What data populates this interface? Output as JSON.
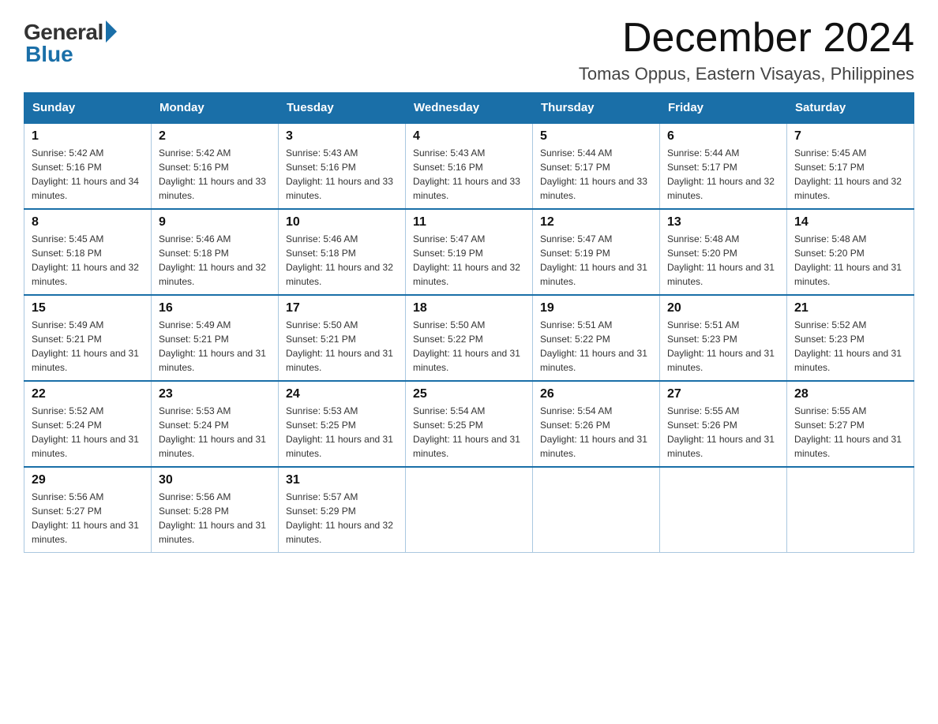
{
  "logo": {
    "general": "General",
    "blue": "Blue"
  },
  "title": "December 2024",
  "location": "Tomas Oppus, Eastern Visayas, Philippines",
  "weekdays": [
    "Sunday",
    "Monday",
    "Tuesday",
    "Wednesday",
    "Thursday",
    "Friday",
    "Saturday"
  ],
  "weeks": [
    [
      {
        "day": "1",
        "sunrise": "5:42 AM",
        "sunset": "5:16 PM",
        "daylight": "11 hours and 34 minutes."
      },
      {
        "day": "2",
        "sunrise": "5:42 AM",
        "sunset": "5:16 PM",
        "daylight": "11 hours and 33 minutes."
      },
      {
        "day": "3",
        "sunrise": "5:43 AM",
        "sunset": "5:16 PM",
        "daylight": "11 hours and 33 minutes."
      },
      {
        "day": "4",
        "sunrise": "5:43 AM",
        "sunset": "5:16 PM",
        "daylight": "11 hours and 33 minutes."
      },
      {
        "day": "5",
        "sunrise": "5:44 AM",
        "sunset": "5:17 PM",
        "daylight": "11 hours and 33 minutes."
      },
      {
        "day": "6",
        "sunrise": "5:44 AM",
        "sunset": "5:17 PM",
        "daylight": "11 hours and 32 minutes."
      },
      {
        "day": "7",
        "sunrise": "5:45 AM",
        "sunset": "5:17 PM",
        "daylight": "11 hours and 32 minutes."
      }
    ],
    [
      {
        "day": "8",
        "sunrise": "5:45 AM",
        "sunset": "5:18 PM",
        "daylight": "11 hours and 32 minutes."
      },
      {
        "day": "9",
        "sunrise": "5:46 AM",
        "sunset": "5:18 PM",
        "daylight": "11 hours and 32 minutes."
      },
      {
        "day": "10",
        "sunrise": "5:46 AM",
        "sunset": "5:18 PM",
        "daylight": "11 hours and 32 minutes."
      },
      {
        "day": "11",
        "sunrise": "5:47 AM",
        "sunset": "5:19 PM",
        "daylight": "11 hours and 32 minutes."
      },
      {
        "day": "12",
        "sunrise": "5:47 AM",
        "sunset": "5:19 PM",
        "daylight": "11 hours and 31 minutes."
      },
      {
        "day": "13",
        "sunrise": "5:48 AM",
        "sunset": "5:20 PM",
        "daylight": "11 hours and 31 minutes."
      },
      {
        "day": "14",
        "sunrise": "5:48 AM",
        "sunset": "5:20 PM",
        "daylight": "11 hours and 31 minutes."
      }
    ],
    [
      {
        "day": "15",
        "sunrise": "5:49 AM",
        "sunset": "5:21 PM",
        "daylight": "11 hours and 31 minutes."
      },
      {
        "day": "16",
        "sunrise": "5:49 AM",
        "sunset": "5:21 PM",
        "daylight": "11 hours and 31 minutes."
      },
      {
        "day": "17",
        "sunrise": "5:50 AM",
        "sunset": "5:21 PM",
        "daylight": "11 hours and 31 minutes."
      },
      {
        "day": "18",
        "sunrise": "5:50 AM",
        "sunset": "5:22 PM",
        "daylight": "11 hours and 31 minutes."
      },
      {
        "day": "19",
        "sunrise": "5:51 AM",
        "sunset": "5:22 PM",
        "daylight": "11 hours and 31 minutes."
      },
      {
        "day": "20",
        "sunrise": "5:51 AM",
        "sunset": "5:23 PM",
        "daylight": "11 hours and 31 minutes."
      },
      {
        "day": "21",
        "sunrise": "5:52 AM",
        "sunset": "5:23 PM",
        "daylight": "11 hours and 31 minutes."
      }
    ],
    [
      {
        "day": "22",
        "sunrise": "5:52 AM",
        "sunset": "5:24 PM",
        "daylight": "11 hours and 31 minutes."
      },
      {
        "day": "23",
        "sunrise": "5:53 AM",
        "sunset": "5:24 PM",
        "daylight": "11 hours and 31 minutes."
      },
      {
        "day": "24",
        "sunrise": "5:53 AM",
        "sunset": "5:25 PM",
        "daylight": "11 hours and 31 minutes."
      },
      {
        "day": "25",
        "sunrise": "5:54 AM",
        "sunset": "5:25 PM",
        "daylight": "11 hours and 31 minutes."
      },
      {
        "day": "26",
        "sunrise": "5:54 AM",
        "sunset": "5:26 PM",
        "daylight": "11 hours and 31 minutes."
      },
      {
        "day": "27",
        "sunrise": "5:55 AM",
        "sunset": "5:26 PM",
        "daylight": "11 hours and 31 minutes."
      },
      {
        "day": "28",
        "sunrise": "5:55 AM",
        "sunset": "5:27 PM",
        "daylight": "11 hours and 31 minutes."
      }
    ],
    [
      {
        "day": "29",
        "sunrise": "5:56 AM",
        "sunset": "5:27 PM",
        "daylight": "11 hours and 31 minutes."
      },
      {
        "day": "30",
        "sunrise": "5:56 AM",
        "sunset": "5:28 PM",
        "daylight": "11 hours and 31 minutes."
      },
      {
        "day": "31",
        "sunrise": "5:57 AM",
        "sunset": "5:29 PM",
        "daylight": "11 hours and 32 minutes."
      },
      null,
      null,
      null,
      null
    ]
  ]
}
